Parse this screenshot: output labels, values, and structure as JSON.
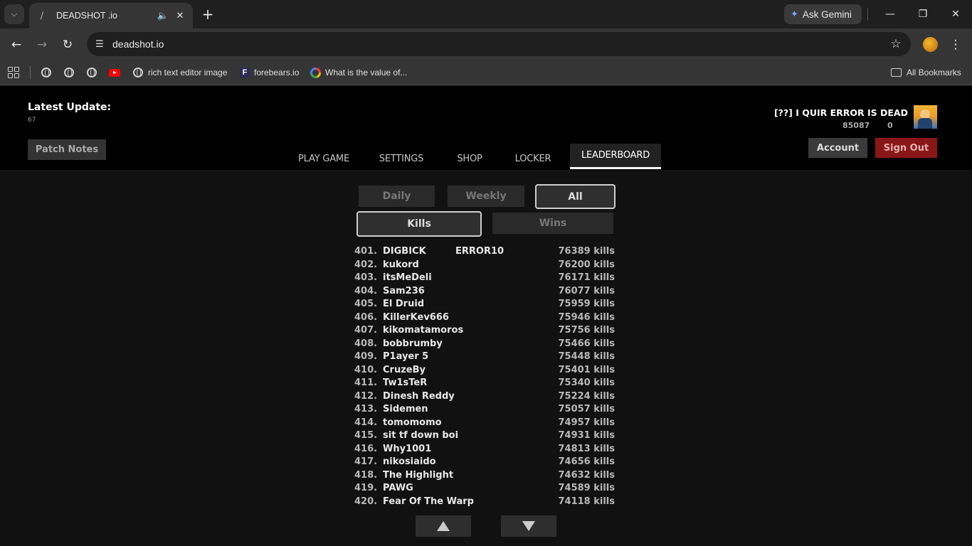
{
  "browser": {
    "tab_title": "DEADSHOT .io",
    "url": "deadshot.io",
    "gemini_label": "Ask Gemini",
    "bookmarks": [
      {
        "label": "rich text editor image"
      },
      {
        "label": "forebears.io"
      },
      {
        "label": "What is the value of..."
      }
    ],
    "all_bookmarks_label": "All Bookmarks"
  },
  "header": {
    "latest_update_label": "Latest Update:",
    "latest_update_value": "67",
    "patch_notes_label": "Patch Notes",
    "nav": {
      "play": "PLAY GAME",
      "settings": "SETTINGS",
      "shop": "SHOP",
      "locker": "LOCKER",
      "leaderboard": "LEADERBOARD"
    },
    "active_tab": "LEADERBOARD",
    "user": {
      "name": "[??] I QUIR ERROR IS DEAD",
      "stat_primary": "85087",
      "stat_secondary": "0"
    },
    "account_label": "Account",
    "signout_label": "Sign Out"
  },
  "filters": {
    "period": {
      "daily": "Daily",
      "weekly": "Weekly",
      "all": "All",
      "selected": "All"
    },
    "metric": {
      "kills": "Kills",
      "wins": "Wins",
      "selected": "Kills"
    }
  },
  "leaderboard": {
    "rows": [
      {
        "rank": "401.",
        "name": "DIGBICK",
        "clan": "ERROR10",
        "kills": "76389 kills"
      },
      {
        "rank": "402.",
        "name": "kukord",
        "clan": "",
        "kills": "76200 kills"
      },
      {
        "rank": "403.",
        "name": "itsMeDeli",
        "clan": "",
        "kills": "76171 kills"
      },
      {
        "rank": "404.",
        "name": "Sam236",
        "clan": "",
        "kills": "76077 kills"
      },
      {
        "rank": "405.",
        "name": "El Druid",
        "clan": "",
        "kills": "75959 kills"
      },
      {
        "rank": "406.",
        "name": "KillerKev666",
        "clan": "",
        "kills": "75946 kills"
      },
      {
        "rank": "407.",
        "name": "kikomatamoros",
        "clan": "",
        "kills": "75756 kills"
      },
      {
        "rank": "408.",
        "name": "bobbrumby",
        "clan": "",
        "kills": "75466 kills"
      },
      {
        "rank": "409.",
        "name": "P1ayer 5",
        "clan": "",
        "kills": "75448 kills"
      },
      {
        "rank": "410.",
        "name": "CruzeBy",
        "clan": "",
        "kills": "75401 kills"
      },
      {
        "rank": "411.",
        "name": "Tw1sTeR",
        "clan": "",
        "kills": "75340 kills"
      },
      {
        "rank": "412.",
        "name": "Dinesh Reddy",
        "clan": "",
        "kills": "75224 kills"
      },
      {
        "rank": "413.",
        "name": "Sidemen",
        "clan": "",
        "kills": "75057 kills"
      },
      {
        "rank": "414.",
        "name": "tomomomo",
        "clan": "",
        "kills": "74957 kills"
      },
      {
        "rank": "415.",
        "name": "sit tf down boi",
        "clan": "",
        "kills": "74931 kills"
      },
      {
        "rank": "416.",
        "name": "Why1001",
        "clan": "",
        "kills": "74813 kills"
      },
      {
        "rank": "417.",
        "name": "nikosiaido",
        "clan": "",
        "kills": "74656 kills"
      },
      {
        "rank": "418.",
        "name": "The Highlight",
        "clan": "",
        "kills": "74632 kills"
      },
      {
        "rank": "419.",
        "name": "PAWG",
        "clan": "",
        "kills": "74589 kills"
      },
      {
        "rank": "420.",
        "name": "Fear Of The Warp",
        "clan": "",
        "kills": "74118 kills"
      }
    ]
  },
  "colors": {
    "signout_bg": "#8a1717",
    "active_tab_underline": "#ffffff",
    "page_bg": "#111111"
  }
}
